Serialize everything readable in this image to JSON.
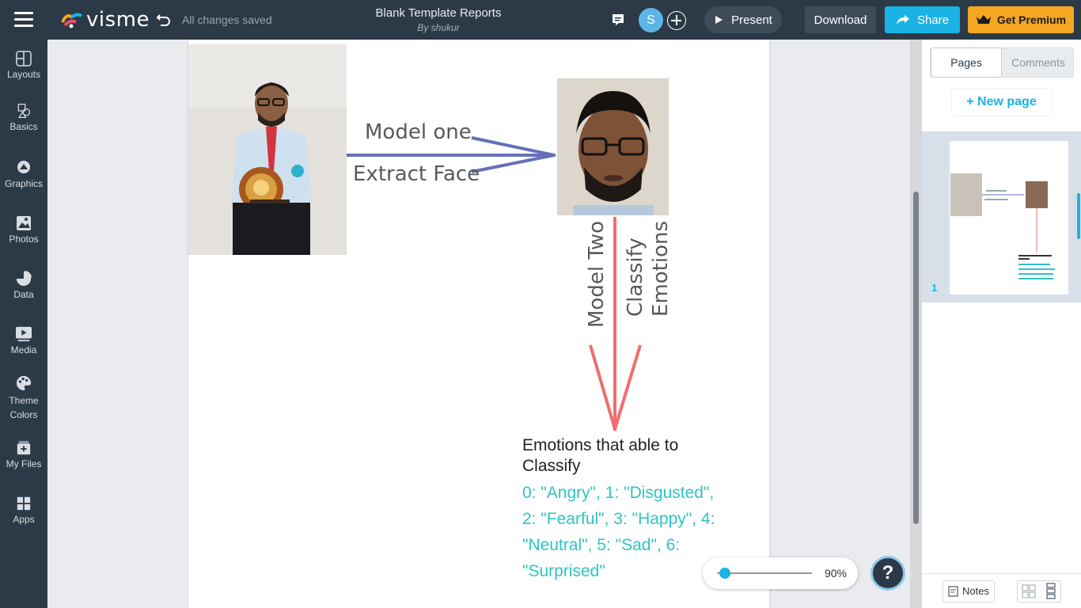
{
  "topbar": {
    "logo_text": "visme",
    "save_status": "All changes saved",
    "doc_title": "Blank Template Reports",
    "doc_author": "By shukur",
    "avatar_initial": "S",
    "present_label": "Present",
    "download_label": "Download",
    "share_label": "Share",
    "premium_label": "Get Premium"
  },
  "sidebar": {
    "items": [
      {
        "label": "Layouts"
      },
      {
        "label": "Basics"
      },
      {
        "label": "Graphics"
      },
      {
        "label": "Photos"
      },
      {
        "label": "Data"
      },
      {
        "label": "Media"
      },
      {
        "label": "Theme Colors"
      },
      {
        "label": "My Files"
      },
      {
        "label": "Apps"
      }
    ]
  },
  "canvas": {
    "model_one": "Model one",
    "extract_face": "Extract Face",
    "model_two": "Model Two",
    "classify": "Classify",
    "emotions": "Emotions",
    "emotions_title": "Emotions that able to Classify",
    "emotions_list": "0: \"Angry\", 1: \"Disgusted\", 2: \"Fearful\", 3: \"Happy\", 4: \"Neutral\", 5: \"Sad\", 6: \"Surprised\""
  },
  "zoom": {
    "value": "90%",
    "level": 0.05
  },
  "right_panel": {
    "tab_pages": "Pages",
    "tab_comments": "Comments",
    "new_page": "+ New page",
    "page_number": "1",
    "notes": "Notes"
  },
  "colors": {
    "bar": "#2c3a47",
    "accent": "#1ab3e3",
    "premium": "#f5a623",
    "arrow_blue": "#6470b8",
    "arrow_red": "#f26d6d",
    "emotion_text": "#2ec4c4"
  }
}
